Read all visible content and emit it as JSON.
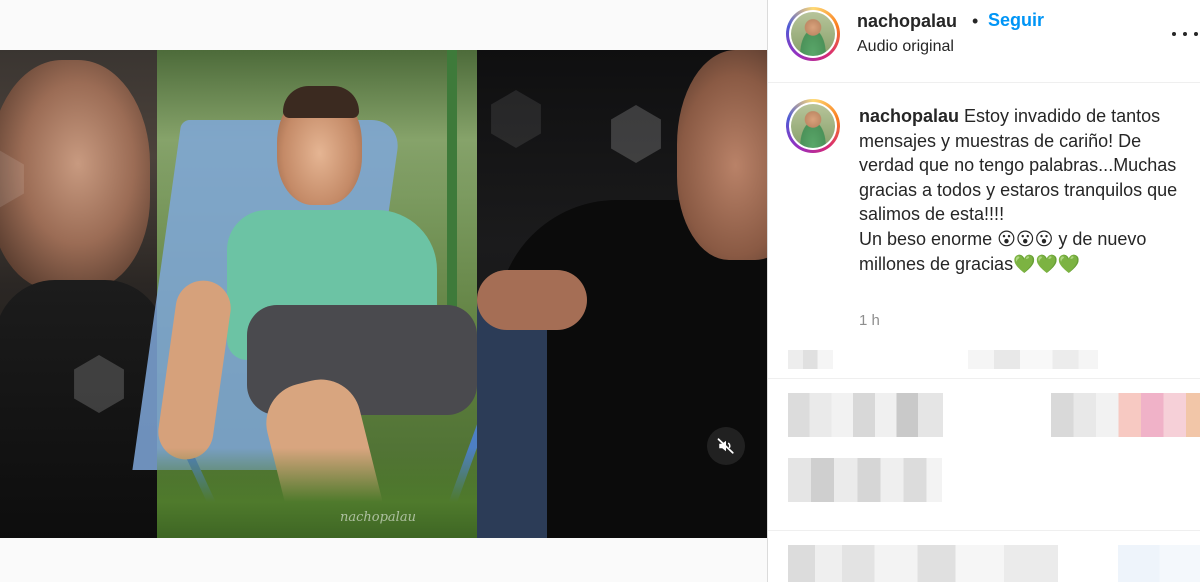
{
  "post": {
    "watermark": "nachopalau",
    "mute_icon": "speaker-muted-icon"
  },
  "header": {
    "username": "nachopalau",
    "separator": "•",
    "follow_label": "Seguir",
    "audio_label": "Audio original",
    "more_icon": "more-options-icon"
  },
  "caption": {
    "username": "nachopalau",
    "text": " Estoy invadido de tantos mensajes y muestras de cariño! De verdad que no tengo palabras...Muchas gracias a todos y estaros tranquilos que salimos de esta!!!!\nUn beso enorme 😮😮😮 y de nuevo millones de gracias💚💚💚",
    "time": "1 h"
  },
  "colors": {
    "link_blue": "#0095f6",
    "text": "#262626",
    "muted": "#8e8e8e",
    "border": "#dbdbdb"
  }
}
